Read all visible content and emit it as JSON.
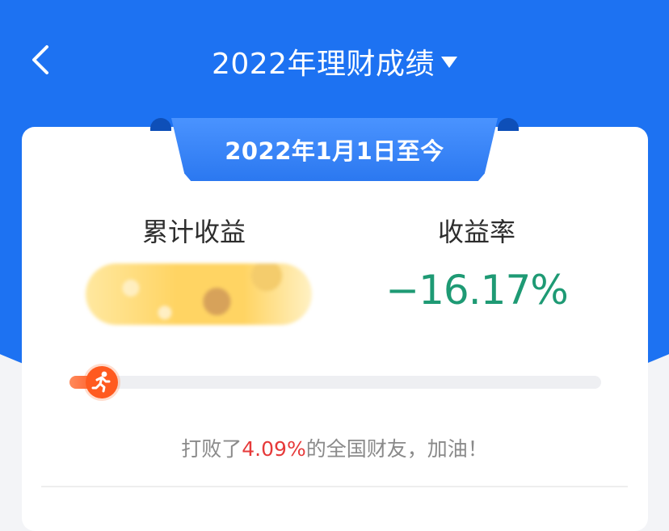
{
  "header": {
    "title": "2022年理财成绩",
    "back_icon": "chevron-left-icon",
    "dropdown_icon": "caret-down-icon"
  },
  "card": {
    "period_label": "2022年1月1日至今",
    "cumulative_earnings_label": "累计收益",
    "cumulative_earnings_value": "",
    "return_rate_label": "收益率",
    "return_rate_value": "−16.17%",
    "progress_percent": 4.09,
    "runner_icon": "runner-icon",
    "beat_prefix": "打败了",
    "beat_percent": "4.09%",
    "beat_suffix": "的全国财友，加油！"
  },
  "colors": {
    "brand_blue": "#1d72f2",
    "loss_green": "#1e9a74",
    "accent_red": "#e63a3a",
    "runner_orange": "#ff5a1f"
  }
}
